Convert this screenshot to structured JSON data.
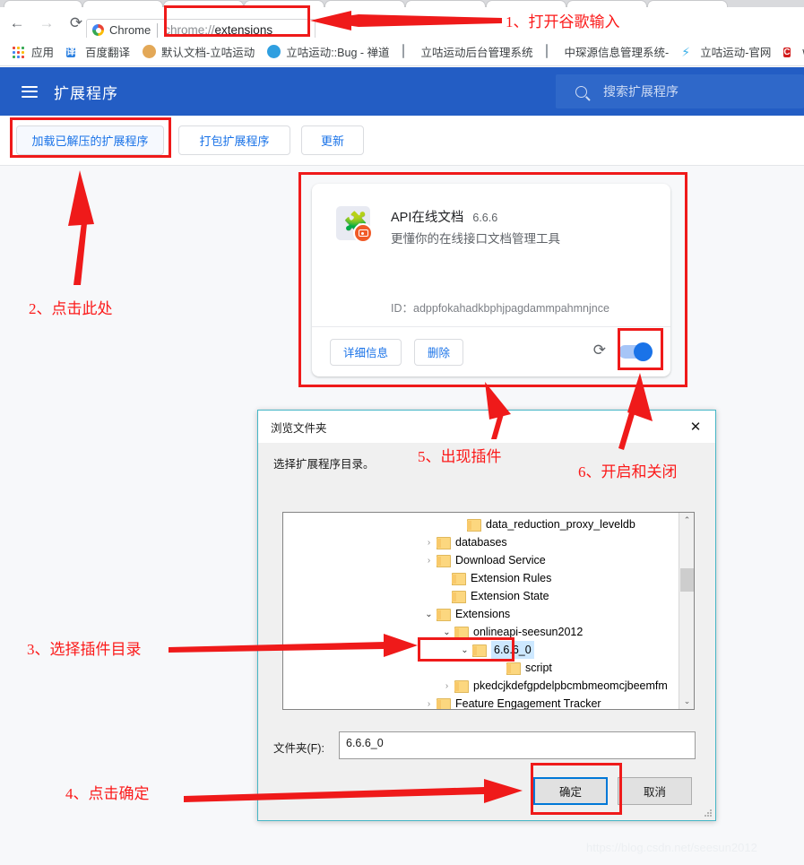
{
  "browser": {
    "nav": {
      "back_icon": "back-arrow-icon",
      "forward_icon": "forward-arrow-icon",
      "reload_icon": "reload-icon",
      "back_glyph": "←",
      "forward_glyph": "→",
      "reload_glyph": "⟳"
    },
    "omnibox": {
      "chip_label": "Chrome",
      "url_scheme": "chrome://",
      "url_path": "extensions",
      "full_url": "chrome://extensions"
    },
    "bookmarks": [
      {
        "label": "应用",
        "icon": "apps-grid-icon",
        "icon_kind": "apps"
      },
      {
        "label": "百度翻译",
        "icon": "translate-icon",
        "icon_kind": "square",
        "icon_text": "译",
        "icon_color": "#2b7fe0"
      },
      {
        "label": "默认文档-立咕运动",
        "icon": "monkey-icon",
        "icon_kind": "glyph",
        "icon_text": "🐵",
        "icon_color": "#d9913f"
      },
      {
        "label": "立咕运动::Bug - 禅道",
        "icon": "zentao-globe-icon",
        "icon_kind": "circle",
        "icon_color": "#2f9fe0"
      },
      {
        "label": "立咕运动后台管理系统",
        "icon": "page-icon",
        "icon_kind": "doc"
      },
      {
        "label": "中琛源信息管理系统-",
        "icon": "page-icon",
        "icon_kind": "doc"
      },
      {
        "label": "立咕运动-官网",
        "icon": "runner-icon",
        "icon_kind": "runner",
        "icon_text": "⚡",
        "icon_color": "#3db0e8"
      },
      {
        "label": "wi",
        "icon": "comodo-c-icon",
        "icon_kind": "square",
        "icon_text": "C",
        "icon_color": "#d21c1c"
      }
    ]
  },
  "extensions_page": {
    "menu_icon": "hamburger-menu-icon",
    "title": "扩展程序",
    "search": {
      "icon": "search-icon",
      "placeholder": "搜索扩展程序"
    },
    "toolbar_buttons": [
      {
        "label": "加载已解压的扩展程序",
        "name": "load-unpacked-button"
      },
      {
        "label": "打包扩展程序",
        "name": "pack-extension-button"
      },
      {
        "label": "更新",
        "name": "update-button"
      }
    ],
    "card": {
      "icon": "puzzle-piece-icon",
      "badge_icon": "camera-badge-icon",
      "name": "API在线文档",
      "version": "6.6.6",
      "description": "更懂你的在线接口文档管理工具",
      "id_label": "ID：",
      "id_value": "adppfokahadkbphjpagdammpahmnjnce",
      "details_label": "详细信息",
      "remove_label": "删除",
      "reload_icon": "reload-extension-icon",
      "reload_glyph": "⟳",
      "toggle_state": "on",
      "toggle_color": "#1a73e8"
    }
  },
  "dialog": {
    "title": "浏览文件夹",
    "close_icon": "close-icon",
    "close_glyph": "✕",
    "prompt": "选择扩展程序目录。",
    "folder_label": "文件夹(F):",
    "folder_value": "6.6.6_0",
    "ok_label": "确定",
    "cancel_label": "取消",
    "tree": [
      {
        "label": "data_reduction_proxy_leveldb",
        "indent": 2,
        "chevron": "none",
        "selected": false
      },
      {
        "label": "databases",
        "indent": 1,
        "chevron": "closed",
        "selected": false
      },
      {
        "label": "Download Service",
        "indent": 1,
        "chevron": "closed",
        "selected": false
      },
      {
        "label": "Extension Rules",
        "indent": 2,
        "chevron": "none",
        "selected": false
      },
      {
        "label": "Extension State",
        "indent": 2,
        "chevron": "none",
        "selected": false
      },
      {
        "label": "Extensions",
        "indent": 1,
        "chevron": "open",
        "selected": false
      },
      {
        "label": "onlineapi-seesun2012",
        "indent": 2,
        "chevron": "open",
        "selected": false
      },
      {
        "label": "6.6.6_0",
        "indent": 3,
        "chevron": "open",
        "selected": true
      },
      {
        "label": "script",
        "indent": 5,
        "chevron": "none",
        "selected": false
      },
      {
        "label": "pkedcjkdefgpdelpbcmbmeomcjbeemfm",
        "indent": 2,
        "chevron": "closed",
        "selected": false
      },
      {
        "label": "Feature Engagement Tracker",
        "indent": 1,
        "chevron": "closed",
        "selected": false
      }
    ],
    "scrollbar": {
      "up_glyph": "⌃",
      "down_glyph": "⌄"
    }
  },
  "annotations": [
    {
      "id": "step1",
      "text": "1、打开谷歌输入"
    },
    {
      "id": "step2",
      "text": "2、点击此处"
    },
    {
      "id": "step3",
      "text": "3、选择插件目录"
    },
    {
      "id": "step4",
      "text": "4、点击确定"
    },
    {
      "id": "step5",
      "text": "5、出现插件"
    },
    {
      "id": "step6",
      "text": "6、开启和关闭"
    }
  ],
  "watermark": "https://blog.csdn.net/seesun2012",
  "colors": {
    "annotation_red": "#fb1a1a",
    "chrome_blue": "#235dc4",
    "link_blue": "#1a73e8",
    "dialog_border": "#45b6c6"
  }
}
